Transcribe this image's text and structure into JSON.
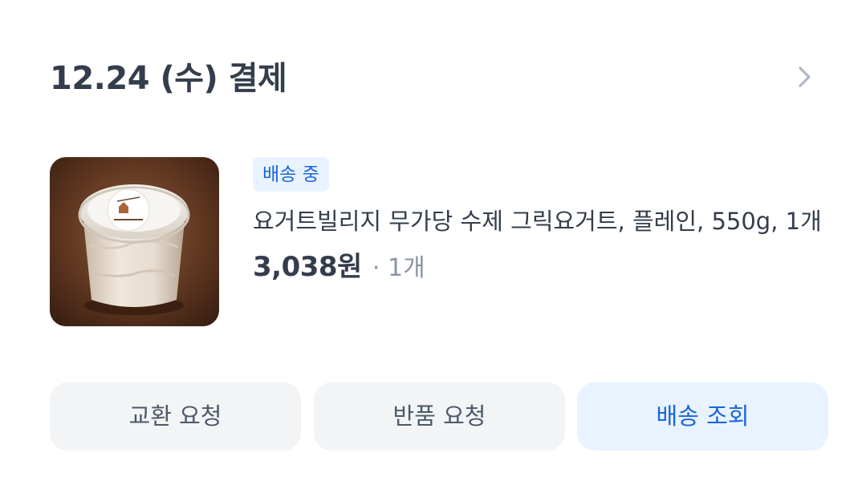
{
  "order": {
    "date_label": "12.24 (수) 결제",
    "detail_icon": "chevron-right-icon"
  },
  "product": {
    "image": "yogurt-cup-thumbnail",
    "status": "배송 중",
    "name": "요거트빌리지 무가당 수제 그릭요거트, 플레인, 550g, 1개",
    "price": "3,038원",
    "quantity": "· 1개"
  },
  "actions": {
    "exchange": "교환 요청",
    "return": "반품 요청",
    "tracking": "배송 조회"
  },
  "colors": {
    "title_text": "#333d4b",
    "secondary_text": "#8b95a1",
    "accent_blue": "#1b64da",
    "badge_bg": "#e8f3ff",
    "button_bg": "#f2f4f6"
  }
}
